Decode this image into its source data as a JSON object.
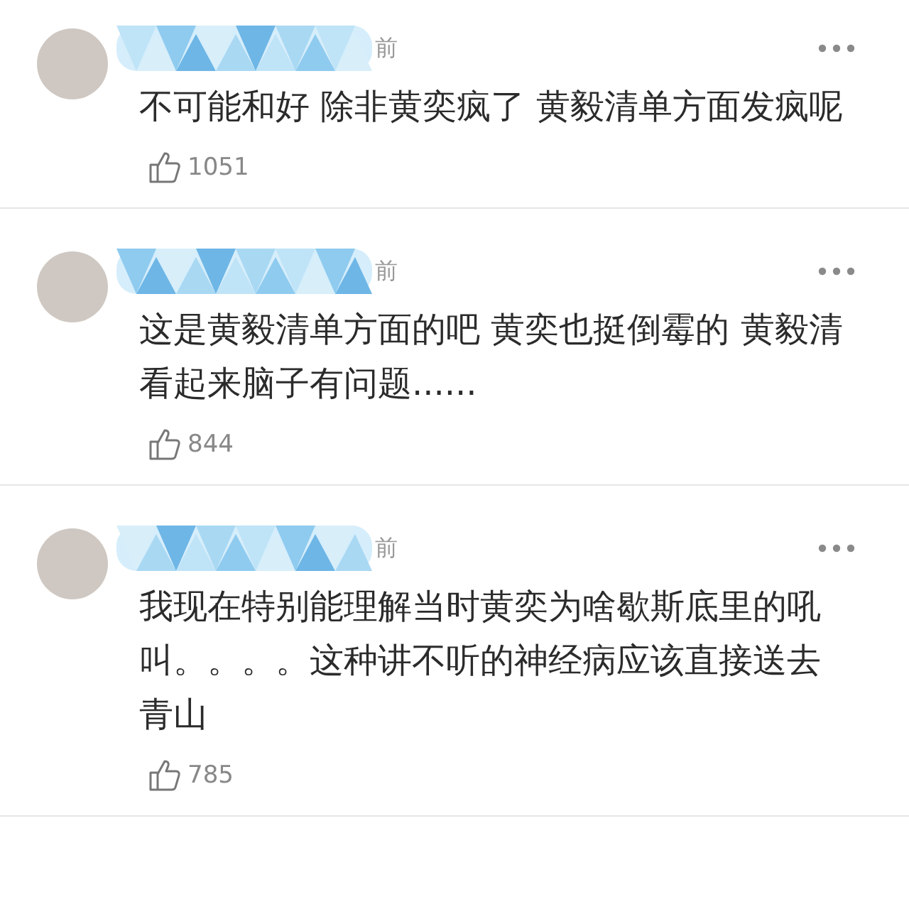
{
  "comments": [
    {
      "author_redacted": true,
      "time": "前",
      "text": "不可能和好 除非黄奕疯了 黄毅清单方面发疯呢",
      "likes": "1051"
    },
    {
      "author_redacted": true,
      "time": "前",
      "text": "这是黄毅清单方面的吧 黄奕也挺倒霉的 黄毅清看起来脑子有问题......",
      "likes": "844"
    },
    {
      "author_redacted": true,
      "time": "前",
      "text": "我现在特别能理解当时黄奕为啥歇斯底里的吼叫。。。。这种讲不听的神经病应该直接送去青山",
      "likes": "785"
    }
  ]
}
